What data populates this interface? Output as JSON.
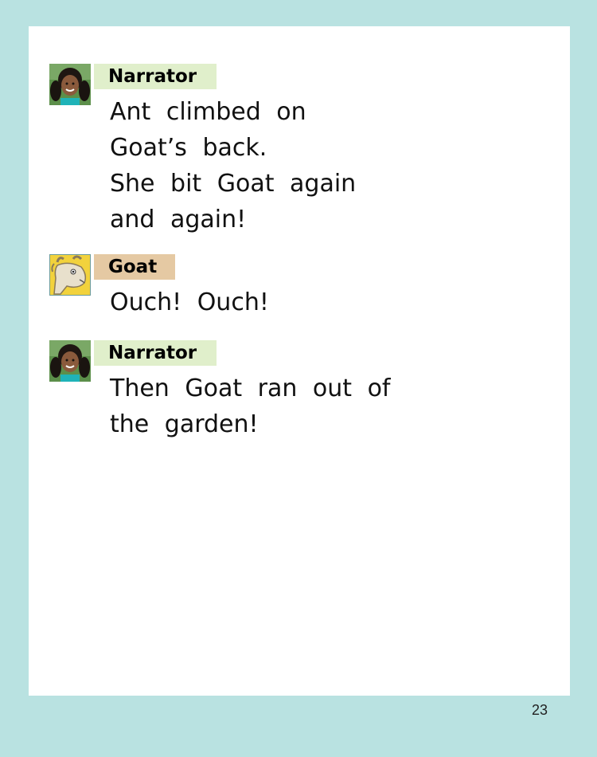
{
  "dialogue": [
    {
      "speaker": "Narrator",
      "avatar_icon": "girl-portrait-icon",
      "tag_color": "#e0efcb",
      "lines": [
        "Ant climbed on",
        "Goat’s back.",
        "She bit Goat again",
        "and again!"
      ]
    },
    {
      "speaker": "Goat",
      "avatar_icon": "goat-portrait-icon",
      "tag_color": "#e5c9a3",
      "lines": [
        "Ouch! Ouch!"
      ]
    },
    {
      "speaker": "Narrator",
      "avatar_icon": "girl-portrait-icon",
      "tag_color": "#e0efcb",
      "lines": [
        "Then Goat ran out of",
        "the garden!"
      ]
    }
  ],
  "page_number": "23",
  "colors": {
    "background": "#b9e2e1",
    "page": "#ffffff"
  }
}
